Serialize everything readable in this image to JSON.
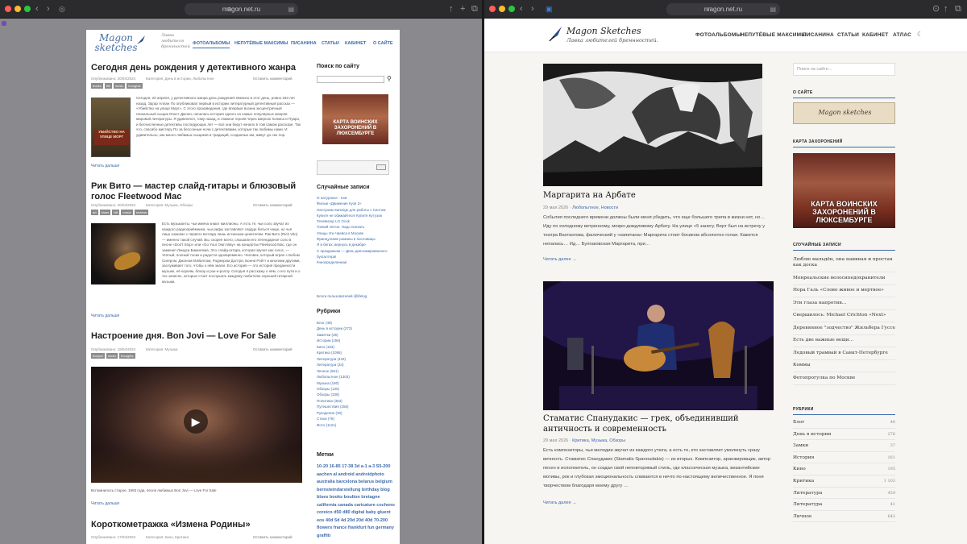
{
  "left_window": {
    "address": "magon.net.ru",
    "site": {
      "logo": "Magon sketches",
      "tagline": "Лавка любителя бреннностей",
      "nav": [
        "ФОТОАЛЬБОМЫ",
        "НЕПУТЁВЫЕ МАКСИМЫ",
        "ПИСАНИНА",
        "СТАТЬИ",
        "КАБИНЕТ",
        "О САЙТЕ"
      ]
    },
    "posts": [
      {
        "title": "Сегодня день рождения у детективного жанра",
        "date": "Опубликовано: 20/04/2024",
        "category": "Категория: День в истории, Любопытное",
        "comment": "Оставить комментарий",
        "tags": [
          "books",
          "life",
          "music",
          "thoughts"
        ],
        "book_text": "УБИЙСТВО НА УЛИЦЕ МОРГ",
        "excerpt": "Сегодня, 20 апреля, у детективного жанра день рождения! Именно в этот день, ровно 183 лет назад, Эдгар Аллан По опубликовал первый в истории литературный детективный рассказ — «Убийство на улице Морг». С этого произведения, где впервые возник эксцентричный гениальный сыщик Огюст Дюпен, началась история одного из самых популярных жанров мировой литературы. Я удивлялся, тому назад, и главное героев через Шерлок Холмса и Пуаро, и бесчисленные детективы последующих лет — все они берут начало в том самом рассказе. Так что, спасибо мистеру По за бессонные ночи с детективами, которые так любимы нами. И удивительно, как много любимых сыщиков и традиций, созданных им, живут до сих пор.",
        "more": "Читать дальше"
      },
      {
        "title": "Рик Вито — мастер слайд-гитары и блюзовый голос Fleetwood Mac",
        "date": "Опубликовано: 20/04/2024",
        "category": "Категория: Музыка, Обзоры",
        "comment": "Оставить комментарий",
        "tags": [
          "art",
          "blues",
          "hifi",
          "music",
          "reviews"
        ],
        "excerpt": "Есть музыканты, чьи имена знают миллионы. А есть те, чьи соло звучат из каждого радиоприёмника, чьи рифы заставляют сердце биться чаще, но чьё лицо знакомо с первого взгляда лишь истинным ценителям. Рик Вито (Rick Vito) — именно такой случай. Вы, скорее всего, слышали его легендарное соло в песне «Don't Stop» или «Go Your Own Way» на концертах Fleetwood Mac, где он заменил Линдси Бакингема. Это слайд-гитара, которая звучит как голос, — тёплый, полный тоски и радости одновременно. Человек, который играл с Бобом Сигером, Джоном Мэйаллом, Роджером Долтри, Бонни Рэйтт и многими другими, заслуживает того, чтобы о нём знали. Его история — это история преданности музыке, её корням, блюзу и рок-н-роллу. Сегодня я расскажу о нём, о его пути и о тех записях, которые стоит послушать каждому любителю хорошей гитарной музыки.",
        "more": "Читать дальше"
      },
      {
        "title": "Настроение дня. Bon Jovi — Love For Sale",
        "date": "Опубликовано: 19/04/2024",
        "category": "Категория: Музыка",
        "comment": "Оставить комментарий",
        "tags": [
          "bonjovi",
          "music",
          "thoughts"
        ],
        "caption": "Вспомнилось старое, 1993 года, песня любимых Bon Jovi — Love For Sale",
        "more": "Читать дальше"
      },
      {
        "title": "Короткометражка «Измена Родины»",
        "date": "Опубликовано: 17/04/2024",
        "category": "Категория: Кино, Критика",
        "comment": "Оставить комментарий"
      }
    ],
    "sidebar": {
      "search_title": "Поиск по сайту",
      "banner_text": "КАРТА ВОИНСКИХ ЗАХОРОНЕНИЙ В ЛЮКСЕМБУРГЕ",
      "random_title": "Случайные записи",
      "random": [
        "О натуроксе - нэж",
        "Фильм «Движение Кузя 2»",
        "Настроим Samsign для работы с Сентом",
        "Купите не обижайтеся! Купите Кутузов",
        "Телевизор LG Ocuk",
        "Тонкий Элтон. Надо поехать",
        "Улицы Уги Чаевса в Москве",
        "Французские романы и пословицы",
        "Я в бегах, вернусь в декабре",
        "С праздником — День дипломированного бухгалтера!",
        "#неопределенная"
      ],
      "instagram": "Блоги пользователей @lifelog",
      "rubrics_title": "Рубрики",
      "rubrics": [
        "Блог (48)",
        "День в истории (273)",
        "Заметки (35)",
        "Истории (156)",
        "Кино (193)",
        "Критика (1095)",
        "Литература (433)",
        "Литература (34)",
        "Личное (651)",
        "Любопытное (1303)",
        "Музыка (180)",
        "Обзоры (130)",
        "Обзоры (338)",
        "Политика (353)",
        "Путешествия (256)",
        "Рукоделие (30)",
        "Стихи (79)",
        "Фото (1121)"
      ],
      "tags_title": "Метки",
      "tagcloud": "10-20 16-85 17-38 3d a-1 a-3 S5-200 aachen al android androidphoto australia barcelona belarus belgium bernsteindarstellung birthday blog blues books boulton bretagne california canada caricature cocheno coreico d50 d80 digital baby gluent eos 40d 5d 4d 20d 20d 40d 70-200 flowers france frankfurt fun germany graffiti"
    }
  },
  "right_window": {
    "address": "magon.net.ru",
    "site": {
      "logo": "Magon Sketches",
      "tagline": "Лавка любителей бреннностей.",
      "nav": [
        "ФОТОАЛЬБОМЫ",
        "НЕПУТЁВЫЕ МАКСИМЫ",
        "ПИСАНИНА",
        "СТАТЬИ",
        "КАБИНЕТ",
        "АТЛАС"
      ]
    },
    "posts": [
      {
        "title": "Маргарита на Арбате",
        "date": "29 мая 2026",
        "cats": "Любопытное, Новости",
        "excerpt": "События последнего времени должны были меня убедить, что еще большего трепа в жизни нет, но… Иду по холодному ветренному, мокро-дождливому Арбату. На улице +5 занегу. Верт был на встречу у театра Вахтангова, фалический у «капитана» Маргарита стоит босиком абсолютно голая. Кажется непалась… Ид… Булгаковская Маргарита, при…",
        "more": "Читать далее"
      },
      {
        "title": "Стаматис Спанудакис — грек, объединивший античность и современность",
        "date": "29 мая 2026",
        "cats": "Критика, Музыка, Обзоры",
        "excerpt": "Есть композиторы, чьи мелодии звучат из каждого утюга, а есть те, кто заставляет умолкнуть сразу вечность. Стаматис Спанудакис (Stamatis Spanoudakis) — из вторых. Композитор, аранжировщик, автор песен и исполнитель, он создал свой неповторимый стиль, где классическая музыка, византийские мотивы, рок и глубокая эмоциональность сливаются в нечто по-настоящему величественное. Я поня творчеством благодаря моему другу …",
        "more": "Читать далее"
      }
    ],
    "sidebar": {
      "search_placeholder": "Поиск на сайте...",
      "about_title": "О САЙТЕ",
      "about_banner": "Magon sketches",
      "map_title": "КАРТА ЗАХОРОНЕНИЙ",
      "map_banner": "КАРТА ВОИНСКИХ ЗАХОРОНЕНИЙ В ЛЮКСЕМБУРГЕ",
      "random_title": "СЛУЧАЙНЫЕ ЗАПИСИ",
      "random": [
        "Люблю мальдён, она наивная и простая как доска",
        "Монреальские велосипедохранители",
        "Нора Галь «Слово живое и мертвое»",
        "Эти глаза напротив…",
        "Свершилось: Michael Crichton «Next»",
        "Деревянное \"зодчество\" Жильбера Гуссе",
        "Есть две важные вещи…",
        "Ледовый трамвай в Санкт-Петербурге",
        "Коммы",
        "Фотопрогулка по Москве"
      ],
      "rubrics_title": "РУБРИКИ",
      "rubrics": [
        {
          "name": "Блог",
          "count": "48"
        },
        {
          "name": "День в истории",
          "count": "276"
        },
        {
          "name": "Замки",
          "count": "37"
        },
        {
          "name": "История",
          "count": "161"
        },
        {
          "name": "Кино",
          "count": "195"
        },
        {
          "name": "Критика",
          "count": "1 103"
        },
        {
          "name": "Литература",
          "count": "459"
        },
        {
          "name": "Литература",
          "count": "41"
        },
        {
          "name": "Личное",
          "count": "642"
        }
      ]
    }
  }
}
